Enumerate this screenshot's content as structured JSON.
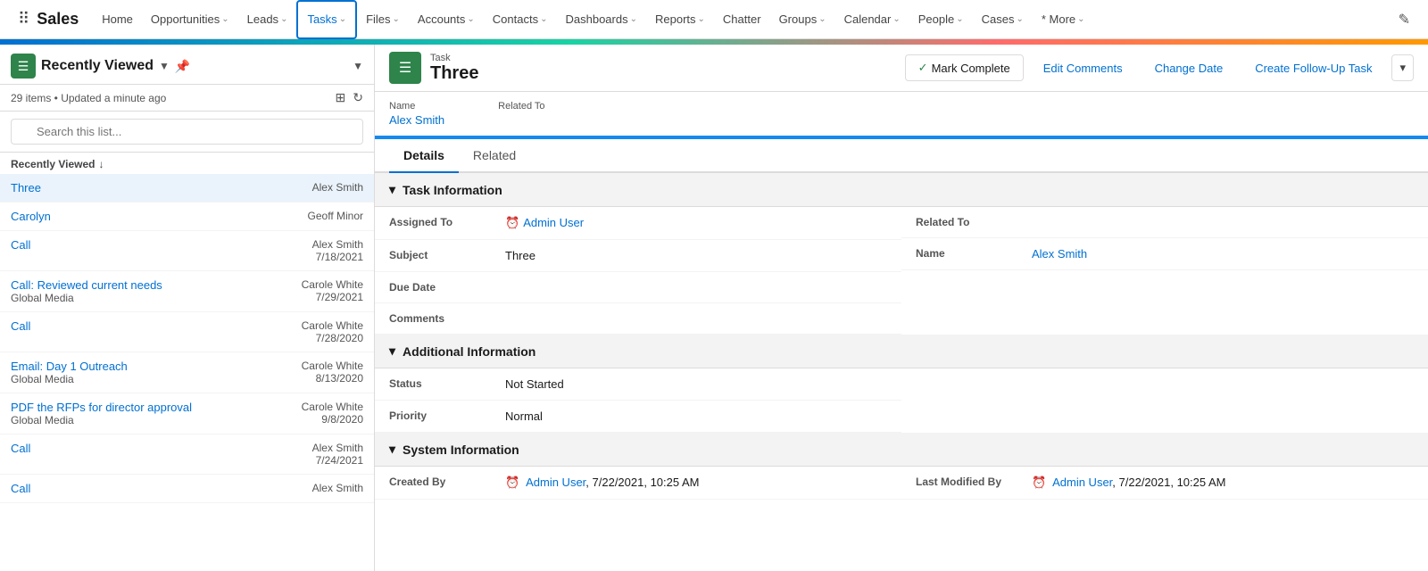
{
  "app": {
    "name": "Sales",
    "edit_icon": "✎"
  },
  "nav": {
    "items": [
      {
        "label": "Home",
        "has_chevron": false,
        "active": false
      },
      {
        "label": "Opportunities",
        "has_chevron": true,
        "active": false
      },
      {
        "label": "Leads",
        "has_chevron": true,
        "active": false
      },
      {
        "label": "Tasks",
        "has_chevron": true,
        "active": true
      },
      {
        "label": "Files",
        "has_chevron": true,
        "active": false
      },
      {
        "label": "Accounts",
        "has_chevron": true,
        "active": false
      },
      {
        "label": "Contacts",
        "has_chevron": true,
        "active": false
      },
      {
        "label": "Dashboards",
        "has_chevron": true,
        "active": false
      },
      {
        "label": "Reports",
        "has_chevron": true,
        "active": false
      },
      {
        "label": "Chatter",
        "has_chevron": false,
        "active": false
      },
      {
        "label": "Groups",
        "has_chevron": true,
        "active": false
      },
      {
        "label": "Calendar",
        "has_chevron": true,
        "active": false
      },
      {
        "label": "People",
        "has_chevron": true,
        "active": false
      },
      {
        "label": "Cases",
        "has_chevron": true,
        "active": false
      },
      {
        "label": "* More",
        "has_chevron": true,
        "active": false
      }
    ]
  },
  "left_panel": {
    "icon": "☰",
    "title": "Recently Viewed",
    "chevron": "▼",
    "pin": "📌",
    "dropdown": "▼",
    "items_count": "29 items • Updated a minute ago",
    "search_placeholder": "Search this list...",
    "list_header": "Recently Viewed",
    "sort_icon": "↓",
    "items": [
      {
        "name": "Three",
        "sub": "",
        "right_name": "Alex Smith",
        "right_date": ""
      },
      {
        "name": "Carolyn",
        "sub": "",
        "right_name": "Geoff Minor",
        "right_date": ""
      },
      {
        "name": "Call",
        "sub": "",
        "right_name": "Alex Smith",
        "right_date": "7/18/2021"
      },
      {
        "name": "Call: Reviewed current needs",
        "sub": "Global Media",
        "right_name": "Carole White",
        "right_date": "7/29/2021"
      },
      {
        "name": "Call",
        "sub": "",
        "right_name": "Carole White",
        "right_date": "7/28/2020"
      },
      {
        "name": "Email: Day 1 Outreach",
        "sub": "Global Media",
        "right_name": "Carole White",
        "right_date": "8/13/2020"
      },
      {
        "name": "PDF the RFPs for director approval",
        "sub": "Global Media",
        "right_name": "Carole White",
        "right_date": "9/8/2020"
      },
      {
        "name": "Call",
        "sub": "",
        "right_name": "Alex Smith",
        "right_date": "7/24/2021"
      },
      {
        "name": "Call",
        "sub": "",
        "right_name": "Alex Smith",
        "right_date": ""
      }
    ]
  },
  "task": {
    "label": "Task",
    "title": "Three",
    "actions": {
      "mark_complete": "Mark Complete",
      "edit_comments": "Edit Comments",
      "change_date": "Change Date",
      "create_followup": "Create Follow-Up Task"
    },
    "name_label": "Name",
    "name_value": "Alex Smith",
    "related_to_label": "Related To",
    "related_to_value": ""
  },
  "tabs": [
    {
      "label": "Details",
      "active": true
    },
    {
      "label": "Related",
      "active": false
    }
  ],
  "sections": {
    "task_information": {
      "title": "Task Information",
      "fields_left": [
        {
          "label": "Assigned To",
          "value": "Admin User",
          "type": "link-icon"
        },
        {
          "label": "Subject",
          "value": "Three",
          "type": "text"
        },
        {
          "label": "Due Date",
          "value": "",
          "type": "text"
        },
        {
          "label": "Comments",
          "value": "",
          "type": "text"
        }
      ],
      "fields_right": [
        {
          "label": "Related To",
          "value": "",
          "type": "text"
        },
        {
          "label": "Name",
          "value": "Alex Smith",
          "type": "link"
        }
      ]
    },
    "additional_information": {
      "title": "Additional Information",
      "fields_left": [
        {
          "label": "Status",
          "value": "Not Started",
          "type": "text"
        },
        {
          "label": "Priority",
          "value": "Normal",
          "type": "text"
        }
      ],
      "fields_right": []
    },
    "system_information": {
      "title": "System Information",
      "fields_left": [
        {
          "label": "Created By",
          "value": "Admin User, 7/22/2021, 10:25 AM",
          "type": "link-icon"
        }
      ],
      "fields_right": [
        {
          "label": "Last Modified By",
          "value": "Admin User, 7/22/2021, 10:25 AM",
          "type": "link-icon"
        }
      ]
    }
  }
}
